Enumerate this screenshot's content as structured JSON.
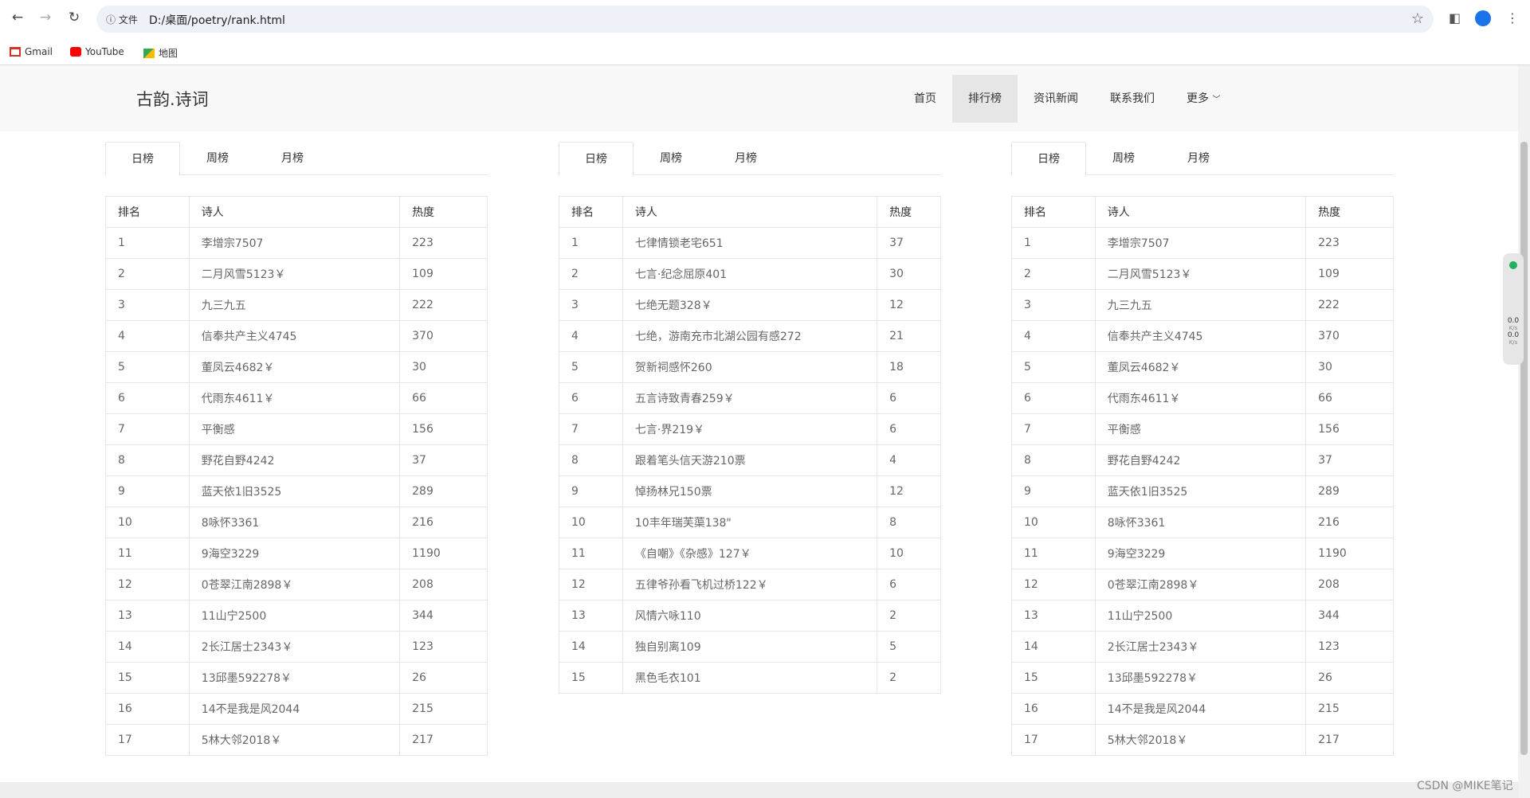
{
  "browser": {
    "url_info_label": "文件",
    "url": "D:/桌面/poetry/rank.html",
    "bookmarks": [
      {
        "label": "Gmail",
        "icon": "gmail-icon"
      },
      {
        "label": "YouTube",
        "icon": "youtube-icon"
      },
      {
        "label": "地图",
        "icon": "maps-icon"
      }
    ]
  },
  "site": {
    "logo": "古韵.诗词",
    "menu": [
      {
        "label": "首页",
        "active": false
      },
      {
        "label": "排行榜",
        "active": true
      },
      {
        "label": "资讯新闻",
        "active": false
      },
      {
        "label": "联系我们",
        "active": false
      },
      {
        "label": "更多",
        "active": false
      }
    ],
    "more_arrow": "﹀"
  },
  "panels": [
    {
      "tabs": [
        "日榜",
        "周榜",
        "月榜"
      ],
      "active_tab": 0,
      "headers": [
        "排名",
        "诗人",
        "热度"
      ],
      "rows": [
        [
          "1",
          "李增宗7507",
          "223"
        ],
        [
          "2",
          "二月风雪5123￥",
          "109"
        ],
        [
          "3",
          "九三九五",
          "222"
        ],
        [
          "4",
          "信奉共产主义4745",
          "370"
        ],
        [
          "5",
          "董凤云4682￥",
          "30"
        ],
        [
          "6",
          "代雨东4611￥",
          "66"
        ],
        [
          "7",
          "平衡感",
          "156"
        ],
        [
          "8",
          "野花自野4242",
          "37"
        ],
        [
          "9",
          "蓝天依1旧3525",
          "289"
        ],
        [
          "10",
          "8咏怀3361",
          "216"
        ],
        [
          "11",
          "9海空3229",
          "1190"
        ],
        [
          "12",
          "0苍翠江南2898￥",
          "208"
        ],
        [
          "13",
          "11山宁2500",
          "344"
        ],
        [
          "14",
          "2长江居士2343￥",
          "123"
        ],
        [
          "15",
          "13邱墨592278￥",
          "26"
        ],
        [
          "16",
          "14不是我是风2044",
          "215"
        ],
        [
          "17",
          "5林大邻2018￥",
          "217"
        ]
      ]
    },
    {
      "tabs": [
        "日榜",
        "周榜",
        "月榜"
      ],
      "active_tab": 0,
      "headers": [
        "排名",
        "诗人",
        "热度"
      ],
      "rows": [
        [
          "1",
          "七律情锁老宅651",
          "37"
        ],
        [
          "2",
          "七言·纪念屈原401",
          "30"
        ],
        [
          "3",
          "七绝无题328￥",
          "12"
        ],
        [
          "4",
          "七绝，游南充市北湖公园有感272",
          "21"
        ],
        [
          "5",
          "贺新祠感怀260",
          "18"
        ],
        [
          "6",
          "五言诗致青春259￥",
          "6"
        ],
        [
          "7",
          "七言·界219￥",
          "6"
        ],
        [
          "8",
          "跟着笔头信天游210票",
          "4"
        ],
        [
          "9",
          "悼扬林兄150票",
          "12"
        ],
        [
          "10",
          "10丰年瑞芙蕖138\"",
          "8"
        ],
        [
          "11",
          "《自嘲》《杂感》127￥",
          "10"
        ],
        [
          "12",
          "五律爷孙看飞机过桥122￥",
          "6"
        ],
        [
          "13",
          "风情六咏110",
          "2"
        ],
        [
          "14",
          "独自别离109",
          "5"
        ],
        [
          "15",
          "黑色毛衣101",
          "2"
        ]
      ]
    },
    {
      "tabs": [
        "日榜",
        "周榜",
        "月榜"
      ],
      "active_tab": 0,
      "headers": [
        "排名",
        "诗人",
        "热度"
      ],
      "rows": [
        [
          "1",
          "李增宗7507",
          "223"
        ],
        [
          "2",
          "二月风雪5123￥",
          "109"
        ],
        [
          "3",
          "九三九五",
          "222"
        ],
        [
          "4",
          "信奉共产主义4745",
          "370"
        ],
        [
          "5",
          "董凤云4682￥",
          "30"
        ],
        [
          "6",
          "代雨东4611￥",
          "66"
        ],
        [
          "7",
          "平衡感",
          "156"
        ],
        [
          "8",
          "野花自野4242",
          "37"
        ],
        [
          "9",
          "蓝天依1旧3525",
          "289"
        ],
        [
          "10",
          "8咏怀3361",
          "216"
        ],
        [
          "11",
          "9海空3229",
          "1190"
        ],
        [
          "12",
          "0苍翠江南2898￥",
          "208"
        ],
        [
          "13",
          "11山宁2500",
          "344"
        ],
        [
          "14",
          "2长江居士2343￥",
          "123"
        ],
        [
          "15",
          "13邱墨592278￥",
          "26"
        ],
        [
          "16",
          "14不是我是风2044",
          "215"
        ],
        [
          "17",
          "5林大邻2018￥",
          "217"
        ]
      ]
    }
  ],
  "overlay": {
    "speed_up": "0.0",
    "speed_unit": "K/s",
    "speed_down": "0.0",
    "watermark": "CSDN @MIKE笔记"
  }
}
